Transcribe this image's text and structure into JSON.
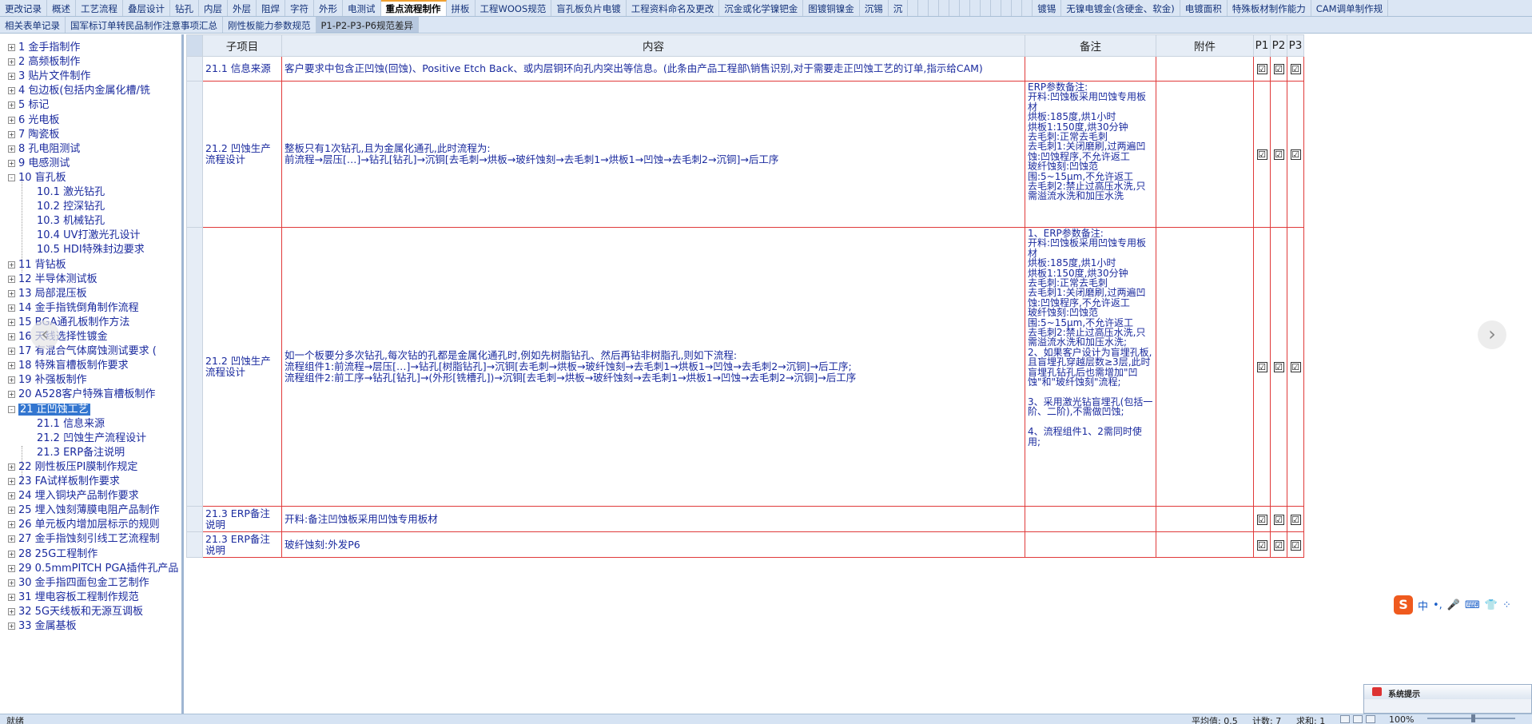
{
  "tabs_top": [
    "更改记录",
    "概述",
    "工艺流程",
    "叠层设计",
    "钻孔",
    "内层",
    "外层",
    "阻焊",
    "字符",
    "外形",
    "电测试",
    "重点流程制作",
    "拼板",
    "工程WOOS规范",
    "盲孔板负片电镀",
    "工程资料命名及更改",
    "沉金或化学镍钯金",
    "图镀铜镍金",
    "沉锡",
    "沉",
    "",
    "",
    "",
    "",
    "",
    "",
    "",
    "",
    "",
    "",
    "",
    "",
    "镀锡",
    "无镍电镀金(含硬金、软金)",
    "电镀面积",
    "特殊板材制作能力",
    "CAM调单制作规"
  ],
  "tabs_top_active": "重点流程制作",
  "tabs_second": [
    "相关表单记录",
    "国军标订单转民品制作注意事项汇总",
    "刚性板能力参数规范",
    "P1-P2-P3-P6规范差异"
  ],
  "tabs_second_active": "P1-P2-P3-P6规范差异",
  "tree": [
    {
      "exp": "+",
      "label": "1  金手指制作"
    },
    {
      "exp": "+",
      "label": "2  高频板制作"
    },
    {
      "exp": "+",
      "label": "3  贴片文件制作"
    },
    {
      "exp": "+",
      "label": "4  包边板(包括内金属化槽/铣"
    },
    {
      "exp": "+",
      "label": "5  标记"
    },
    {
      "exp": "+",
      "label": "6  光电板"
    },
    {
      "exp": "+",
      "label": "7  陶瓷板"
    },
    {
      "exp": "+",
      "label": "8  孔电阻测试"
    },
    {
      "exp": "+",
      "label": "9  电感测试"
    },
    {
      "exp": "-",
      "label": "10  盲孔板"
    },
    {
      "exp": "",
      "label": "10.1  激光钻孔",
      "child": true
    },
    {
      "exp": "",
      "label": "10.2  控深钻孔",
      "child": true
    },
    {
      "exp": "",
      "label": "10.3  机械钻孔",
      "child": true
    },
    {
      "exp": "",
      "label": "10.4  UV打激光孔设计",
      "child": true
    },
    {
      "exp": "",
      "label": "10.5  HDI特殊封边要求",
      "child": true
    },
    {
      "exp": "+",
      "label": "11  背钻板"
    },
    {
      "exp": "+",
      "label": "12  半导体测试板"
    },
    {
      "exp": "+",
      "label": "13  局部混压板"
    },
    {
      "exp": "+",
      "label": "14  金手指铣倒角制作流程"
    },
    {
      "exp": "+",
      "label": "15  BGA通孔板制作方法"
    },
    {
      "exp": "+",
      "label": "16  天线选择性镀金"
    },
    {
      "exp": "+",
      "label": "17  有混合气体腐蚀测试要求 ("
    },
    {
      "exp": "+",
      "label": "18  特殊盲槽板制作要求"
    },
    {
      "exp": "+",
      "label": "19  补强板制作"
    },
    {
      "exp": "+",
      "label": "20  A528客户特殊盲槽板制作"
    },
    {
      "exp": "-",
      "label": "21  正凹蚀工艺",
      "selected": true
    },
    {
      "exp": "",
      "label": "21.1  信息来源",
      "child": true
    },
    {
      "exp": "",
      "label": "21.2  凹蚀生产流程设计",
      "child": true
    },
    {
      "exp": "",
      "label": "21.3  ERP备注说明",
      "child": true
    },
    {
      "exp": "+",
      "label": "22  刚性板压PI膜制作规定"
    },
    {
      "exp": "+",
      "label": "23  FA试样板制作要求"
    },
    {
      "exp": "+",
      "label": "24  埋入铜块产品制作要求"
    },
    {
      "exp": "+",
      "label": "25  埋入蚀刻薄膜电阻产品制作"
    },
    {
      "exp": "+",
      "label": "26  单元板内增加层标示的规则"
    },
    {
      "exp": "+",
      "label": "27  金手指蚀刻引线工艺流程制"
    },
    {
      "exp": "+",
      "label": "28  25G工程制作"
    },
    {
      "exp": "+",
      "label": "29  0.5mmPITCH PGA插件孔产品"
    },
    {
      "exp": "+",
      "label": "30  金手指四面包金工艺制作"
    },
    {
      "exp": "+",
      "label": "31  埋电容板工程制作规范"
    },
    {
      "exp": "+",
      "label": "32  5G天线板和无源互调板"
    },
    {
      "exp": "+",
      "label": "33  金属基板"
    }
  ],
  "grid": {
    "headers": {
      "sub": "子项目",
      "content": "内容",
      "note": "备注",
      "attach": "附件",
      "p1": "P1",
      "p2": "P2",
      "p3": "P3"
    },
    "rows": [
      {
        "sub": "21.1 信息来源",
        "content": "客户要求中包含正凹蚀(回蚀)、Positive Etch Back、或内层铜环向孔内突出等信息。(此条由产品工程部\\销售识别,对于需要走正凹蚀工艺的订单,指示给CAM)",
        "note": "",
        "attach": "",
        "check": "☑"
      },
      {
        "sub": "21.2 凹蚀生产流程设计",
        "content": "整板只有1次钻孔,且为金属化通孔,此时流程为:\n前流程→层压[…]→钻孔[钻孔]→沉铜[去毛刺→烘板→玻纤蚀刻→去毛刺1→烘板1→凹蚀→去毛刺2→沉铜]→后工序",
        "note": "ERP参数备注:\n开料:凹蚀板采用凹蚀专用板材\n烘板:185度,烘1小时\n烘板1:150度,烘30分钟\n去毛刺:正常去毛刺\n去毛刺1:关闭磨刷,过两遍凹蚀:凹蚀程序,不允许返工\n玻纤蚀刻:凹蚀范围:5~15μm,不允许返工\n去毛刺2:禁止过高压水洗,只需溢流水洗和加压水洗",
        "attach": "",
        "check": "☑"
      },
      {
        "sub": "21.2 凹蚀生产流程设计",
        "content": "如一个板要分多次钻孔,每次钻的孔都是金属化通孔时,例如先树脂钻孔、然后再钻非树脂孔,则如下流程:\n流程组件1:前流程→层压[…]→钻孔[树脂钻孔]→沉铜[去毛刺→烘板→玻纤蚀刻→去毛刺1→烘板1→凹蚀→去毛刺2→沉铜]→后工序;\n流程组件2:前工序→钻孔[钻孔]→(外形[铣槽孔])→沉铜[去毛刺→烘板→玻纤蚀刻→去毛刺1→烘板1→凹蚀→去毛刺2→沉铜]→后工序",
        "note": "1、ERP参数备注:\n开料:凹蚀板采用凹蚀专用板材\n烘板:185度,烘1小时\n烘板1:150度,烘30分钟\n去毛刺:正常去毛刺\n去毛刺1:关闭磨刷,过两遍凹蚀:凹蚀程序,不允许返工\n玻纤蚀刻:凹蚀范围:5~15μm,不允许返工\n去毛刺2:禁止过高压水洗,只需溢流水洗和加压水洗;\n2、如果客户设计为盲埋孔板,且盲埋孔穿越层数≥3层,此时盲埋孔钻孔后也需增加\"凹蚀\"和\"玻纤蚀刻\"流程;\n\n3、采用激光钻盲埋孔(包括一阶、二阶),不需做凹蚀;\n\n4、流程组件1、2需同时使用;",
        "attach": "",
        "check": "☑"
      },
      {
        "sub": "21.3 ERP备注说明",
        "content": "开料:备注凹蚀板采用凹蚀专用板材",
        "note": "",
        "attach": "",
        "check": "☑"
      },
      {
        "sub": "21.3 ERP备注说明",
        "content": "玻纤蚀刻:外发P6",
        "note": "",
        "attach": "",
        "check": "☑"
      }
    ]
  },
  "ime": {
    "logo": "S",
    "items": [
      "中",
      "•,",
      "🎤",
      "⌨",
      "👕",
      "⁘"
    ]
  },
  "popup": {
    "title": "系统提示"
  },
  "status": {
    "ready": "就绪",
    "avg": "平均值: 0.5",
    "count": "计数: 7",
    "sum": "求和: 1",
    "zoom": "100%"
  },
  "nav": {
    "prev": "‹",
    "next": "›"
  },
  "colors": {
    "grid_border": "#e03a3a",
    "text": "#1a2a9e",
    "selected": "#3376d0",
    "tabbar": "#dbe6f4"
  }
}
